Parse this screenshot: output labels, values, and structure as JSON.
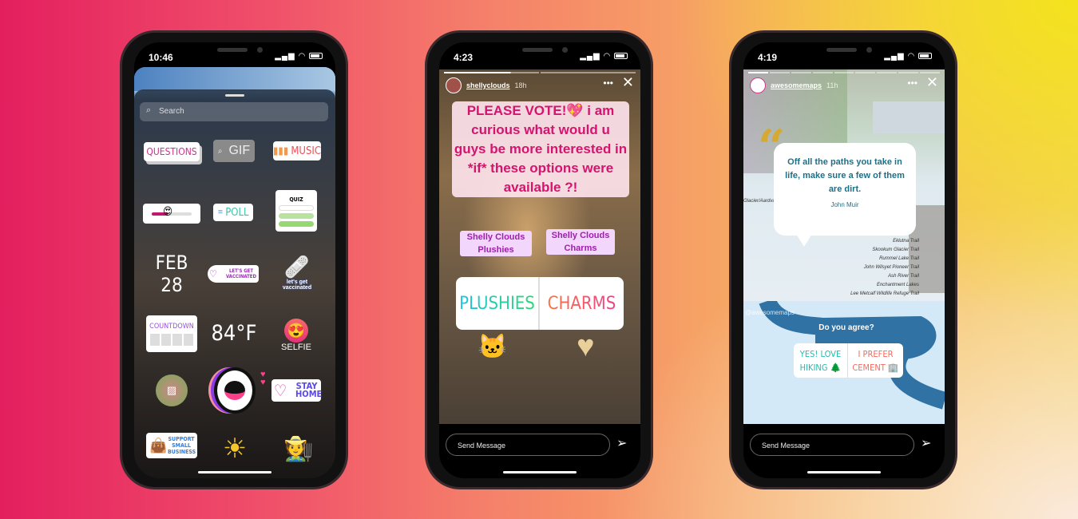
{
  "phones": [
    {
      "time": "10:46",
      "search_placeholder": "Search",
      "stickers": {
        "questions": "QUESTIONS",
        "gif": "GIF",
        "music": "MUSIC",
        "poll": "POLL",
        "quiz": "QUIZ",
        "date": "FEB 28",
        "vaccinated": "LET'S GET VACCINATED",
        "vaccinated2": "let's get vaccinated",
        "countdown": "COUNTDOWN",
        "temperature": "84°F",
        "selfie": "SELFIE",
        "stay_home": "STAY HOME",
        "support_small_business": "SUPPORT SMALL BUSINESS"
      }
    },
    {
      "time": "4:23",
      "username": "shellyclouds",
      "ago": "18h",
      "caption": "PLEASE VOTE!💖 i am curious what would u guys be more interested in *if* these options were available ?!",
      "label_left": "Shelly Clouds Plushies",
      "label_right": "Shelly Clouds Charms",
      "poll": {
        "left": "PLUSHIES",
        "right": "CHARMS"
      },
      "message_placeholder": "Send Message"
    },
    {
      "time": "4:19",
      "username": "awesomemaps",
      "ago": "11h",
      "quote": "Off all the paths you take in life, make sure a few of them are dirt.",
      "author": "John Muir",
      "map_labels": [
        "Glacier/Aardvark",
        "Eklutna Trail",
        "Skookum Glacier Trail",
        "Rummel Lake Trail",
        "John Wilsyet Pioneer Trail",
        "Ash River Trail",
        "Enchantment Lakes",
        "Lee Metcalf Wildlife Refuge Trail"
      ],
      "mention": "@awesomemaps",
      "question": "Do you agree?",
      "poll": {
        "left": "YES! LOVE HIKING 🌲",
        "right": "I PREFER CEMENT 🏢"
      },
      "message_placeholder": "Send Message"
    }
  ],
  "colors": {
    "questions": "#d4308f",
    "poll_caption": "#d6136e",
    "caption_bg": "#fde3ec",
    "label_bg": "#f3d6fb",
    "label_text": "#a21caf",
    "quote_text": "#1f6f86",
    "quote_mark": "#d4a934",
    "map_blue": "#2f72a3"
  }
}
